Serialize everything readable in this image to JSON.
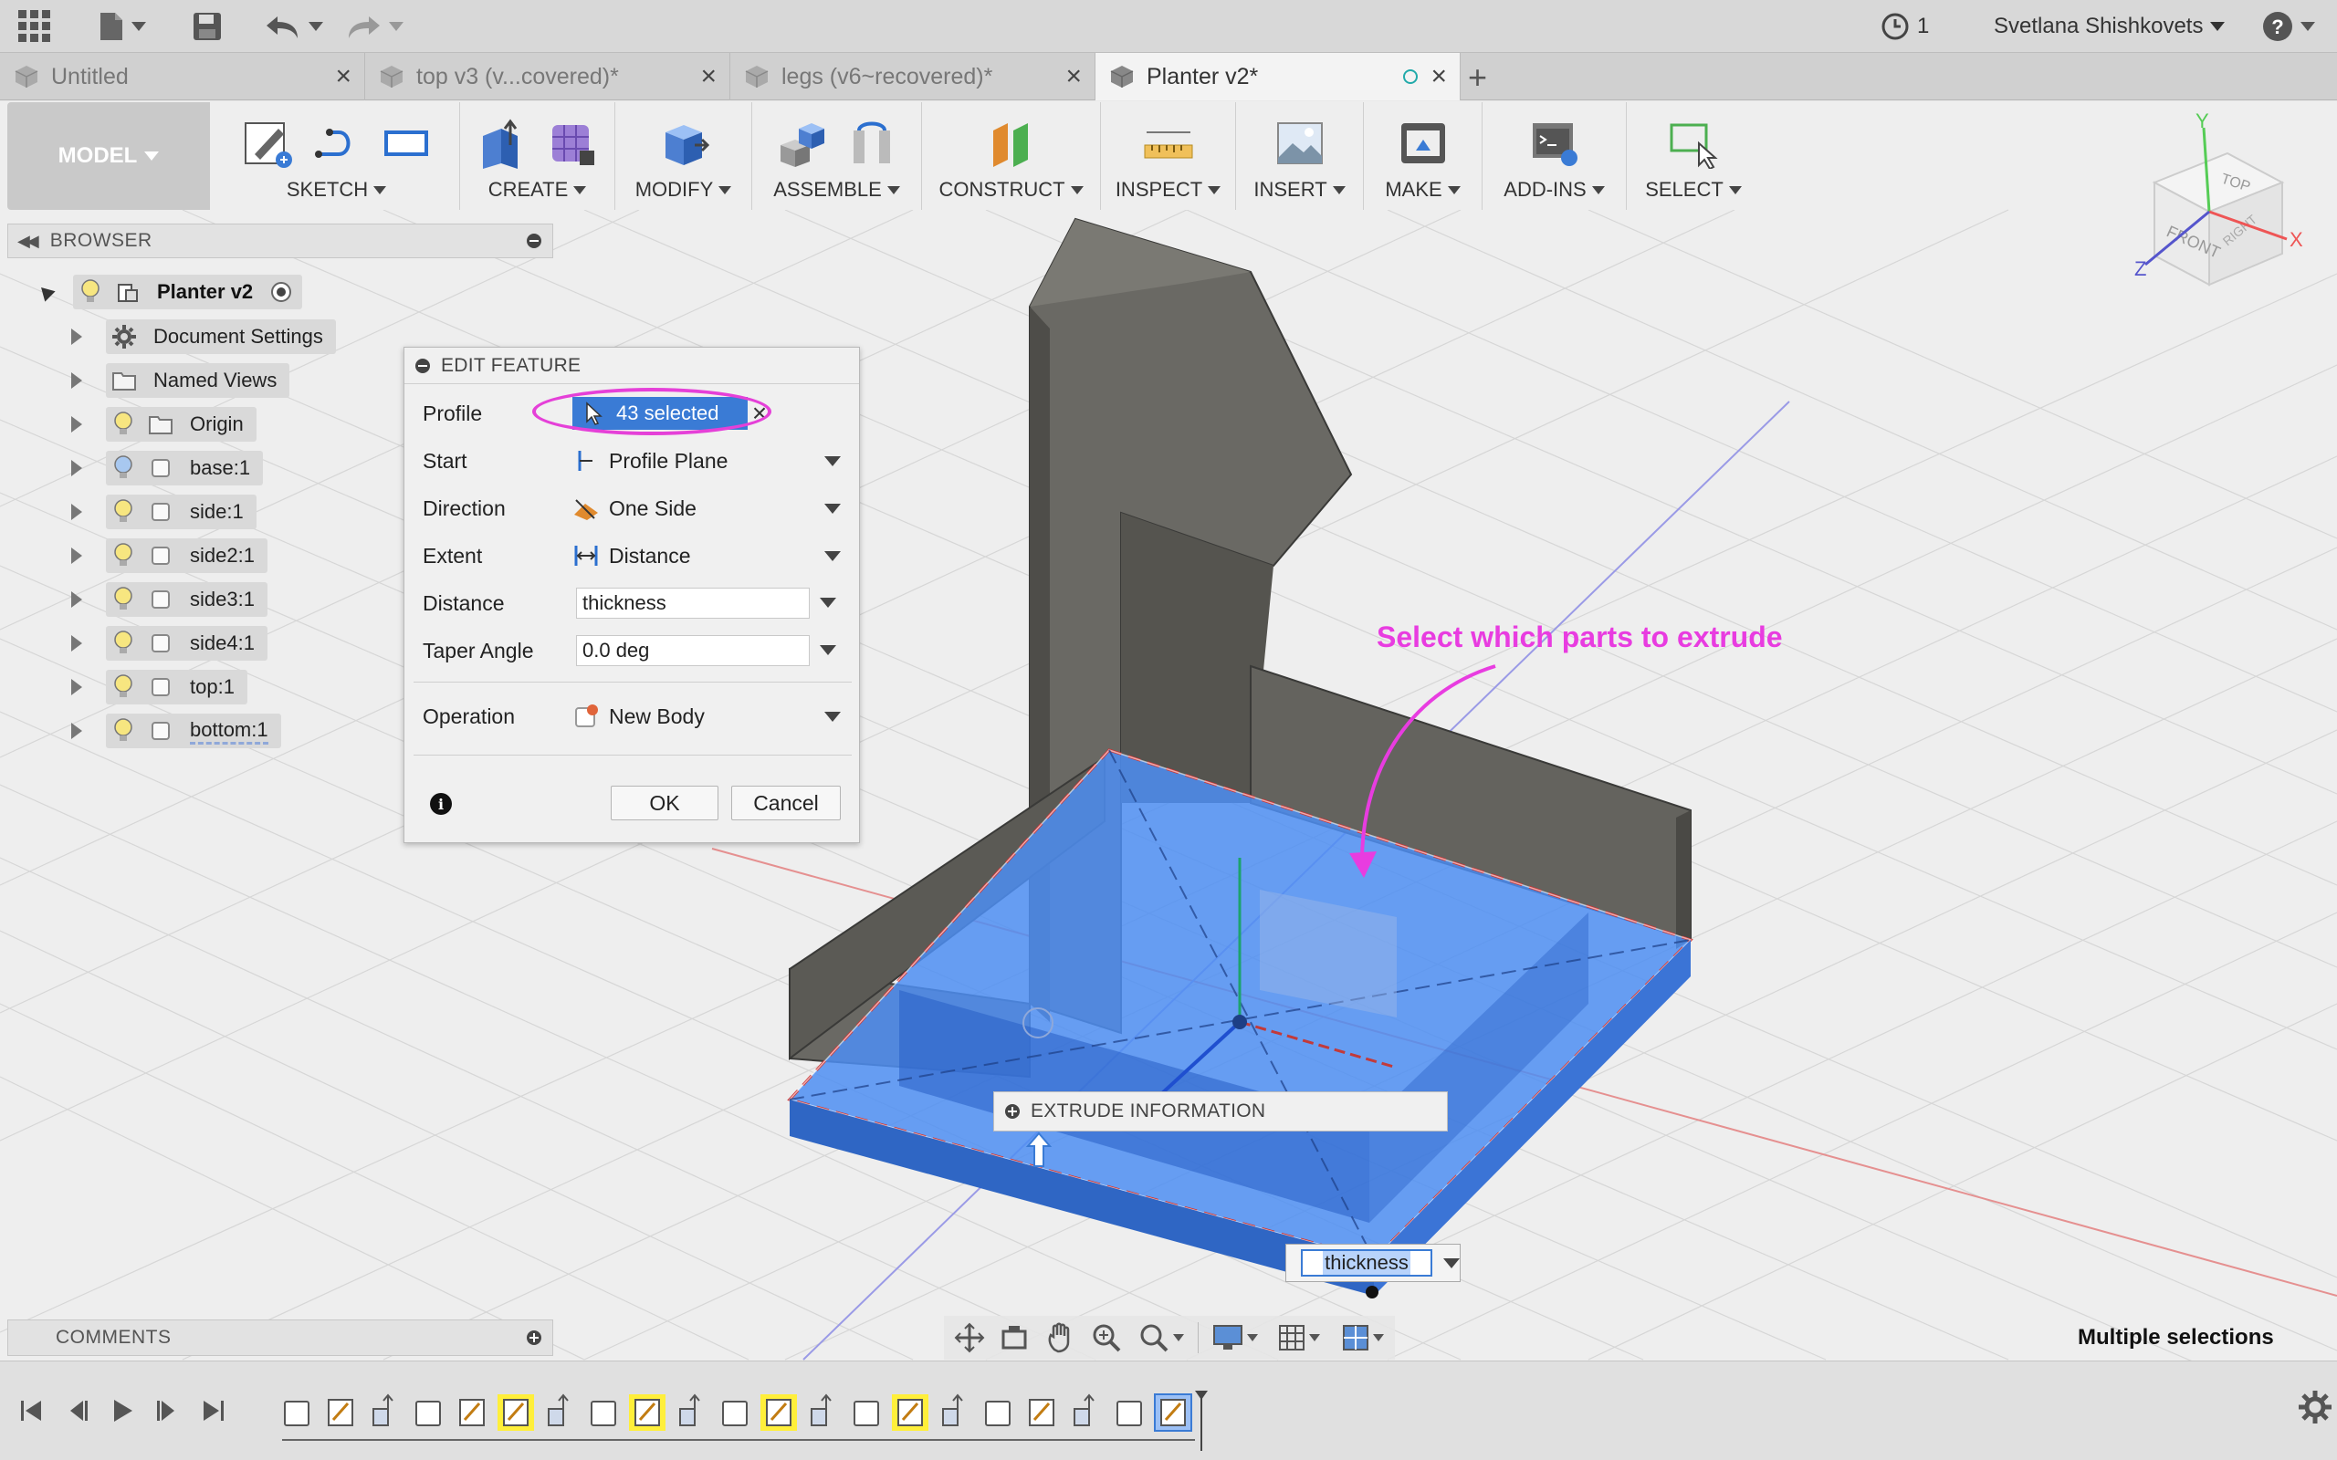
{
  "app": {
    "jobs_count": "1",
    "user_name": "Svetlana Shishkovets"
  },
  "tabs": [
    {
      "label": "Untitled",
      "active": false
    },
    {
      "label": "top v3 (v...covered)*",
      "active": false
    },
    {
      "label": "legs (v6~recovered)*",
      "active": false
    },
    {
      "label": "Planter v2*",
      "active": true
    }
  ],
  "toolbar": {
    "workspace": "MODEL",
    "groups": [
      "SKETCH",
      "CREATE",
      "MODIFY",
      "ASSEMBLE",
      "CONSTRUCT",
      "INSPECT",
      "INSERT",
      "MAKE",
      "ADD-INS",
      "SELECT"
    ]
  },
  "browser": {
    "title": "BROWSER",
    "root": "Planter v2",
    "items": [
      {
        "label": "Document Settings",
        "icon": "gear-icon"
      },
      {
        "label": "Named Views",
        "icon": "folder-icon"
      },
      {
        "label": "Origin",
        "icon": "folder-icon"
      },
      {
        "label": "base:1",
        "icon": "body-icon"
      },
      {
        "label": "side:1",
        "icon": "body-icon"
      },
      {
        "label": "side2:1",
        "icon": "body-icon"
      },
      {
        "label": "side3:1",
        "icon": "body-icon"
      },
      {
        "label": "side4:1",
        "icon": "body-icon"
      },
      {
        "label": "top:1",
        "icon": "body-icon"
      },
      {
        "label": "bottom:1",
        "icon": "body-icon"
      }
    ]
  },
  "comments": {
    "title": "COMMENTS"
  },
  "dialog": {
    "title": "EDIT FEATURE",
    "profile_label": "Profile",
    "profile_value": "43 selected",
    "start_label": "Start",
    "start_value": "Profile Plane",
    "direction_label": "Direction",
    "direction_value": "One Side",
    "extent_label": "Extent",
    "extent_value": "Distance",
    "distance_label": "Distance",
    "distance_value": "thickness",
    "taper_label": "Taper Angle",
    "taper_value": "0.0 deg",
    "operation_label": "Operation",
    "operation_value": "New Body",
    "ok_label": "OK",
    "cancel_label": "Cancel"
  },
  "annotation": "Select which parts to extrude",
  "extrude_info": "EXTRUDE INFORMATION",
  "thickness_input": "thickness",
  "status": "Multiple selections",
  "viewcube": {
    "top": "TOP",
    "front": "FRONT",
    "right": "RIGHT",
    "x": "X",
    "y": "Y",
    "z": "Z"
  },
  "colors": {
    "accent": "#3a7bd5",
    "annotation": "#e83ce0",
    "selection_fill": "#4d8ef2",
    "body": "#5f5e5a"
  }
}
